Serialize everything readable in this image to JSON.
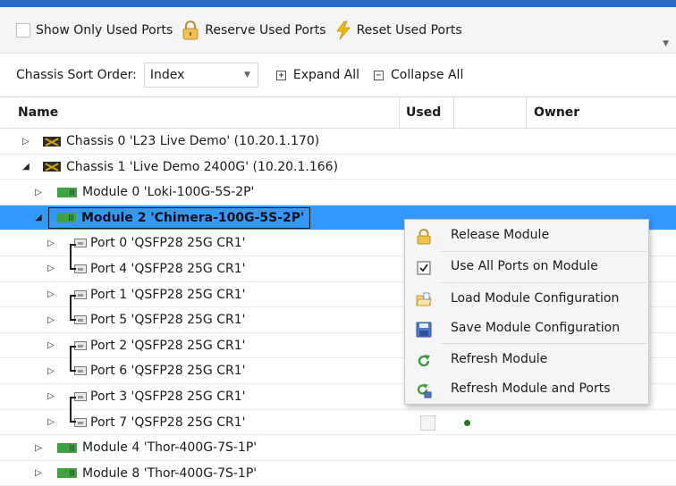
{
  "toolbar": {
    "show_only_used_ports": "Show Only Used Ports",
    "reserve_used_ports": "Reserve Used Ports",
    "reset_used_ports": "Reset Used Ports"
  },
  "sort": {
    "label": "Chassis Sort Order:",
    "value": "Index",
    "expand_all": "Expand All",
    "collapse_all": "Collapse All"
  },
  "grid": {
    "columns": [
      "Name",
      "Used",
      "",
      "Owner"
    ],
    "rows": [
      {
        "label": "Chassis 0 'L23 Live Demo' (10.20.1.170)",
        "kind": "chassis",
        "expander": "collapsed"
      },
      {
        "label": "Chassis 1 'Live Demo 2400G' (10.20.1.166)",
        "kind": "chassis",
        "expander": "expanded"
      },
      {
        "label": "Module 0 'Loki-100G-5S-2P'",
        "kind": "module",
        "expander": "collapsed"
      },
      {
        "label": "Module 2 'Chimera-100G-5S-2P'",
        "kind": "module",
        "expander": "expanded",
        "selected": true
      },
      {
        "label": "Port 0 'QSFP28 25G CR1'",
        "kind": "port",
        "expander": "collapsed"
      },
      {
        "label": "Port 4 'QSFP28 25G CR1'",
        "kind": "port",
        "expander": "collapsed"
      },
      {
        "label": "Port 1 'QSFP28 25G CR1'",
        "kind": "port",
        "expander": "collapsed"
      },
      {
        "label": "Port 5 'QSFP28 25G CR1'",
        "kind": "port",
        "expander": "collapsed"
      },
      {
        "label": "Port 2 'QSFP28 25G CR1'",
        "kind": "port",
        "expander": "collapsed"
      },
      {
        "label": "Port 6 'QSFP28 25G CR1'",
        "kind": "port",
        "expander": "collapsed"
      },
      {
        "label": "Port 3 'QSFP28 25G CR1'",
        "kind": "port",
        "expander": "collapsed"
      },
      {
        "label": "Port 7 'QSFP28 25G CR1'",
        "kind": "port",
        "expander": "collapsed"
      },
      {
        "label": "Module 4 'Thor-400G-7S-1P'",
        "kind": "module",
        "expander": "collapsed"
      },
      {
        "label": "Module 8 'Thor-400G-7S-1P'",
        "kind": "module",
        "expander": "collapsed"
      }
    ]
  },
  "context_menu": {
    "items": [
      {
        "label": "Release Module",
        "icon": "lock-icon"
      },
      {
        "label": "Use All Ports on Module",
        "icon": "checkbox-icon"
      },
      {
        "label": "Load Module Configuration",
        "icon": "folder-open-icon"
      },
      {
        "label": "Save Module Configuration",
        "icon": "save-icon"
      },
      {
        "label": "Refresh Module",
        "icon": "refresh-icon"
      },
      {
        "label": "Refresh Module and Ports",
        "icon": "refresh-all-icon"
      }
    ]
  },
  "colors": {
    "accent": "#2b6cc4",
    "selection": "#3399ff",
    "module_green": "#3fa43f"
  }
}
